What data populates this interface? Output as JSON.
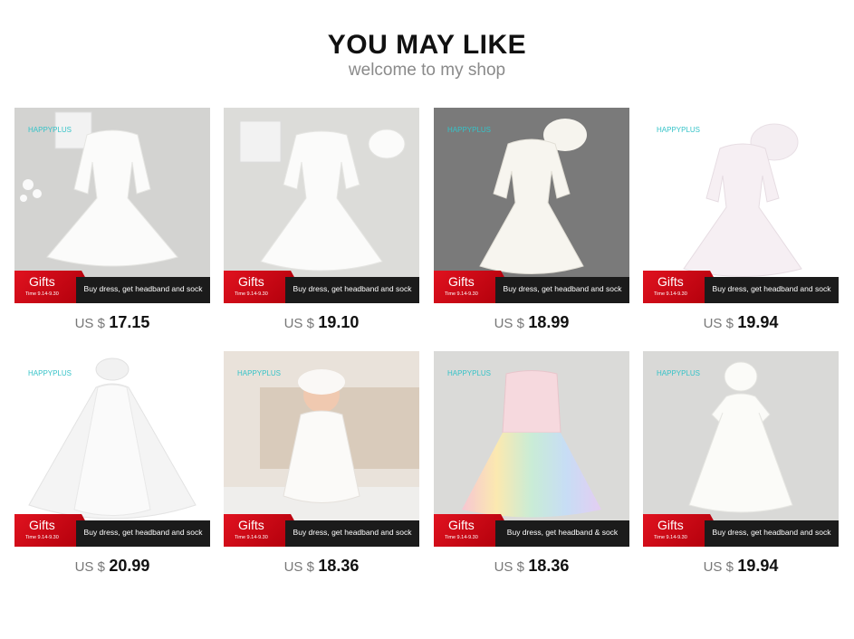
{
  "header": {
    "title": "YOU MAY LIKE",
    "subtitle": "welcome to my shop"
  },
  "banner": {
    "gifts": "Gifts",
    "time": "Time 9.14-9.30",
    "promo_default": "Buy dress, get headband and sock",
    "promo_alt": "Buy dress, get headband & sock"
  },
  "colors": {
    "gifts_red": "#d0101c",
    "promo_black": "#1b1b1b",
    "brand_teal": "#35c3c8"
  },
  "products": [
    {
      "brand": "HAPPYPLUS",
      "currency": "US $",
      "price": "17.15",
      "promo": "Buy dress, get headband and sock"
    },
    {
      "brand": "",
      "currency": "US $",
      "price": "19.10",
      "promo": "Buy dress, get headband and sock"
    },
    {
      "brand": "HAPPYPLUS",
      "currency": "US $",
      "price": "18.99",
      "promo": "Buy dress, get headband and sock"
    },
    {
      "brand": "HAPPYPLUS",
      "currency": "US $",
      "price": "19.94",
      "promo": "Buy dress, get headband and sock"
    },
    {
      "brand": "HAPPYPLUS",
      "currency": "US $",
      "price": "20.99",
      "promo": "Buy dress, get headband and sock"
    },
    {
      "brand": "HAPPYPLUS",
      "currency": "US $",
      "price": "18.36",
      "promo": "Buy dress, get headband and sock"
    },
    {
      "brand": "HAPPYPLUS",
      "currency": "US $",
      "price": "18.36",
      "promo": "Buy dress, get headband & sock"
    },
    {
      "brand": "HAPPYPLUS",
      "currency": "US $",
      "price": "19.94",
      "promo": "Buy dress, get headband and sock"
    }
  ]
}
